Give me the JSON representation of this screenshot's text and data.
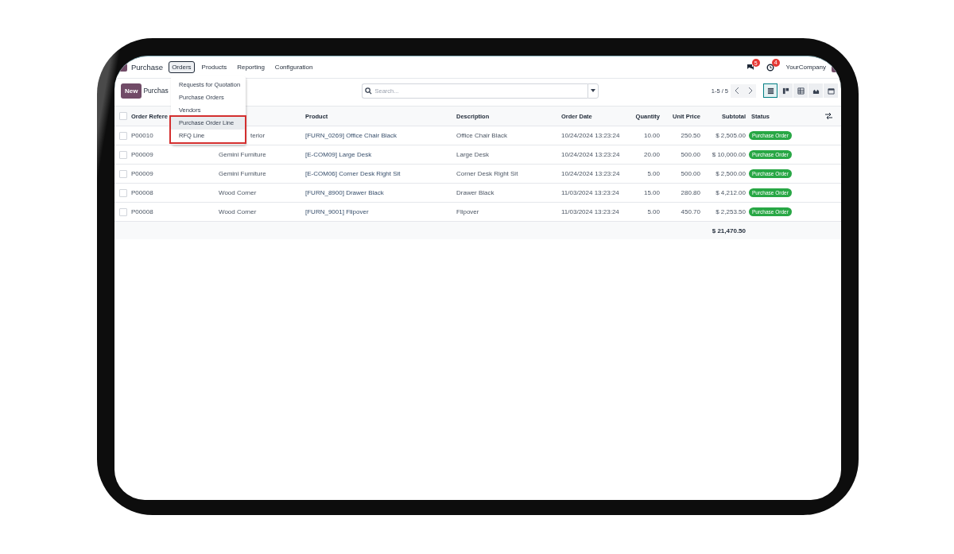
{
  "navbar": {
    "app": "Purchase",
    "menu": [
      {
        "label": "Orders",
        "selected": true
      },
      {
        "label": "Products",
        "selected": false
      },
      {
        "label": "Reporting",
        "selected": false
      },
      {
        "label": "Configuration",
        "selected": false
      }
    ],
    "messages_badge": "5",
    "activities_badge": "4",
    "company": "YourCompany"
  },
  "dropdown": {
    "items": [
      {
        "label": "Requests for Quotation",
        "selected": false,
        "highlighted": false
      },
      {
        "label": "Purchase Orders",
        "selected": false,
        "highlighted": false
      },
      {
        "label": "Vendors",
        "selected": false,
        "highlighted": false
      },
      {
        "label": "Purchase Order Line",
        "selected": true,
        "highlighted": true
      },
      {
        "label": "RFQ Line",
        "selected": false,
        "highlighted": true
      }
    ]
  },
  "control": {
    "new_button": "New",
    "breadcrumb": "Purchas",
    "search": {
      "placeholder": "Search..."
    },
    "pager": "1-5 / 5",
    "views": [
      {
        "kind": "list",
        "selected": true
      },
      {
        "kind": "kanban",
        "selected": false
      },
      {
        "kind": "pivot",
        "selected": false
      },
      {
        "kind": "graph",
        "selected": false
      },
      {
        "kind": "calendar",
        "selected": false
      }
    ]
  },
  "table": {
    "select_all_checked": false,
    "columns": [
      "Order Refere",
      "",
      "Product",
      "Description",
      "Order Date",
      "Quantity",
      "Unit Price",
      "Subtotal",
      "Status"
    ],
    "rows": [
      {
        "checked": false,
        "reference": "P00010",
        "vendor": "terior",
        "product": "[FURN_0269] Office Chair Black",
        "description": "Office Chair Black",
        "order_date": "10/24/2024 13:23:24",
        "quantity": "10.00",
        "unit_price": "250.50",
        "subtotal": "$ 2,505.00",
        "status": "Purchase Order"
      },
      {
        "checked": false,
        "reference": "P00009",
        "vendor": "Gemini Furniture",
        "product": "[E-COM09] Large Desk",
        "description": "Large Desk",
        "order_date": "10/24/2024 13:23:24",
        "quantity": "20.00",
        "unit_price": "500.00",
        "subtotal": "$ 10,000.00",
        "status": "Purchase Order"
      },
      {
        "checked": false,
        "reference": "P00009",
        "vendor": "Gemini Furniture",
        "product": "[E-COM06] Corner Desk Right Sit",
        "description": "Corner Desk Right Sit",
        "order_date": "10/24/2024 13:23:24",
        "quantity": "5.00",
        "unit_price": "500.00",
        "subtotal": "$ 2,500.00",
        "status": "Purchase Order"
      },
      {
        "checked": false,
        "reference": "P00008",
        "vendor": "Wood Corner",
        "product": "[FURN_8900] Drawer Black",
        "description": "Drawer Black",
        "order_date": "11/03/2024 13:23:24",
        "quantity": "15.00",
        "unit_price": "280.80",
        "subtotal": "$ 4,212.00",
        "status": "Purchase Order"
      },
      {
        "checked": false,
        "reference": "P00008",
        "vendor": "Wood Corner",
        "product": "[FURN_9001] Flipover",
        "description": "Flipover",
        "order_date": "11/03/2024 13:23:24",
        "quantity": "5.00",
        "unit_price": "450.70",
        "subtotal": "$ 2,253.50",
        "status": "Purchase Order"
      }
    ],
    "total": "$ 21,470.50"
  }
}
